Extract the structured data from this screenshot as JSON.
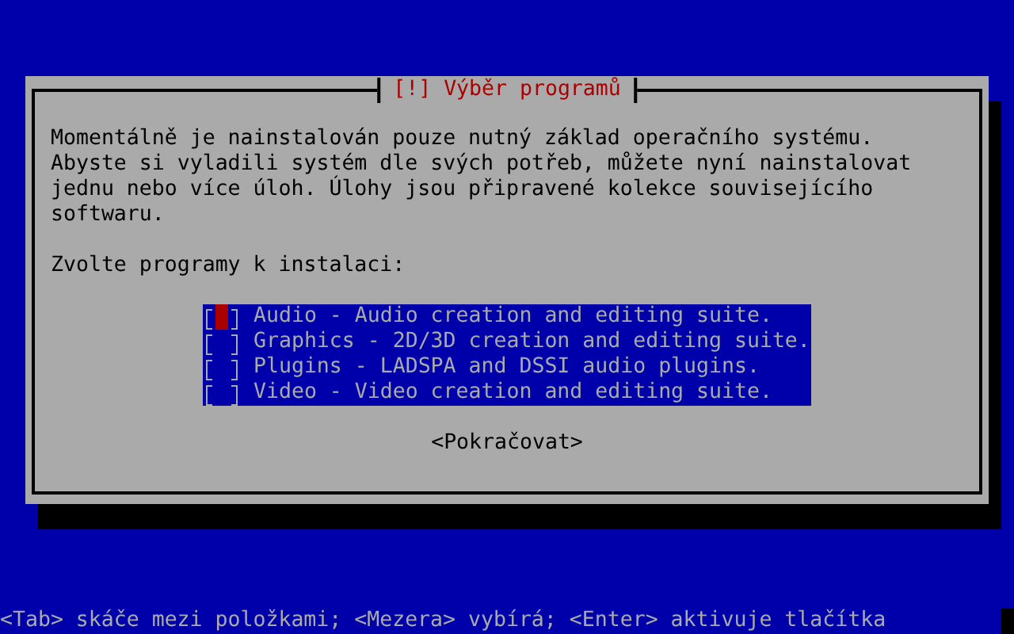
{
  "dialog": {
    "title": "[!] Výběr programů",
    "message": "Momentálně je nainstalován pouze nutný základ operačního systému. Abyste si vyladili systém dle svých potřeb, můžete nyní nainstalovat jednu nebo více úloh. Úlohy jsou připravené kolekce souvisejícího softwaru.",
    "prompt": "Zvolte programy k instalaci:",
    "options": [
      {
        "label": "Audio - Audio creation and editing suite.",
        "checked": false,
        "selected": true
      },
      {
        "label": "Graphics - 2D/3D creation and editing suite.",
        "checked": false,
        "selected": false
      },
      {
        "label": "Plugins - LADSPA and DSSI audio plugins.",
        "checked": false,
        "selected": false
      },
      {
        "label": "Video - Video creation and editing suite.",
        "checked": false,
        "selected": false
      }
    ],
    "button": "<Pokračovat>"
  },
  "status_bar": "<Tab> skáče mezi položkami; <Mezera> vybírá; <Enter> aktivuje tlačítka"
}
